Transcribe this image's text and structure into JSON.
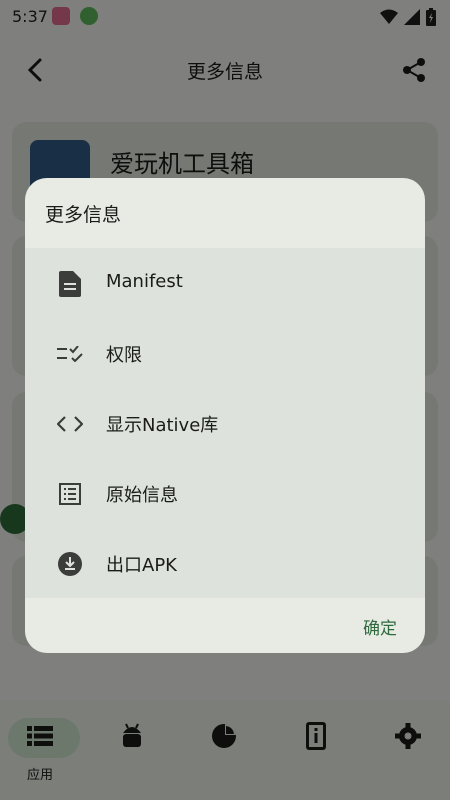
{
  "status_bar": {
    "time": "5:37"
  },
  "top_bar": {
    "title": "更多信息"
  },
  "app_header": {
    "name": "爱玩机工具箱"
  },
  "bottom_nav": {
    "items": [
      {
        "label": "应用",
        "icon": "list-icon",
        "active": true
      },
      {
        "label": "",
        "icon": "android-icon",
        "active": false
      },
      {
        "label": "",
        "icon": "pie-chart-icon",
        "active": false
      },
      {
        "label": "",
        "icon": "phone-info-icon",
        "active": false
      },
      {
        "label": "",
        "icon": "settings-icon",
        "active": false
      }
    ]
  },
  "dialog": {
    "title": "更多信息",
    "items": [
      {
        "label": "Manifest",
        "icon": "document-icon"
      },
      {
        "label": "权限",
        "icon": "checklist-icon"
      },
      {
        "label": "显示Native库",
        "icon": "code-icon"
      },
      {
        "label": "原始信息",
        "icon": "list-box-icon"
      },
      {
        "label": "出口APK",
        "icon": "download-icon"
      }
    ],
    "confirm_label": "确定"
  },
  "colors": {
    "accent": "#2e6a3e",
    "dialog_bg": "#e7ebe4",
    "list_bg": "#dde3dc",
    "scrim": "rgba(0,0,0,0.48)"
  }
}
